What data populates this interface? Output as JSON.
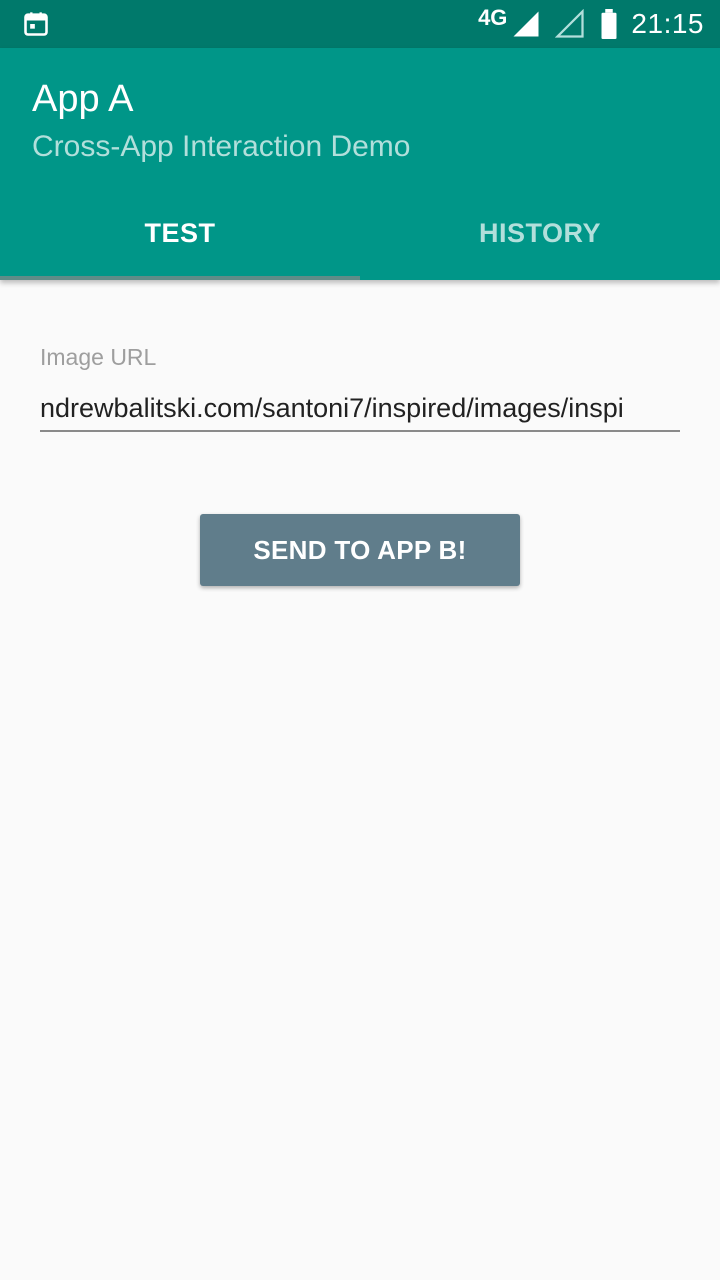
{
  "status_bar": {
    "left_icon": "calendar-icon",
    "network_type": "4G",
    "signal_icon_1": "signal-full-icon",
    "signal_icon_2": "signal-empty-icon",
    "battery_icon": "battery-icon",
    "time": "21:15"
  },
  "app_bar": {
    "title": "App A",
    "subtitle": "Cross-App Interaction Demo",
    "color": "#009688"
  },
  "tabs": [
    {
      "label": "TEST",
      "active": true
    },
    {
      "label": "HISTORY",
      "active": false
    }
  ],
  "form": {
    "image_url_label": "Image URL",
    "image_url_value": "ndrewbalitski.com/santoni7/inspired/images/inspi"
  },
  "send_button": {
    "label": "SEND TO APP B!",
    "color": "#607d8b"
  }
}
